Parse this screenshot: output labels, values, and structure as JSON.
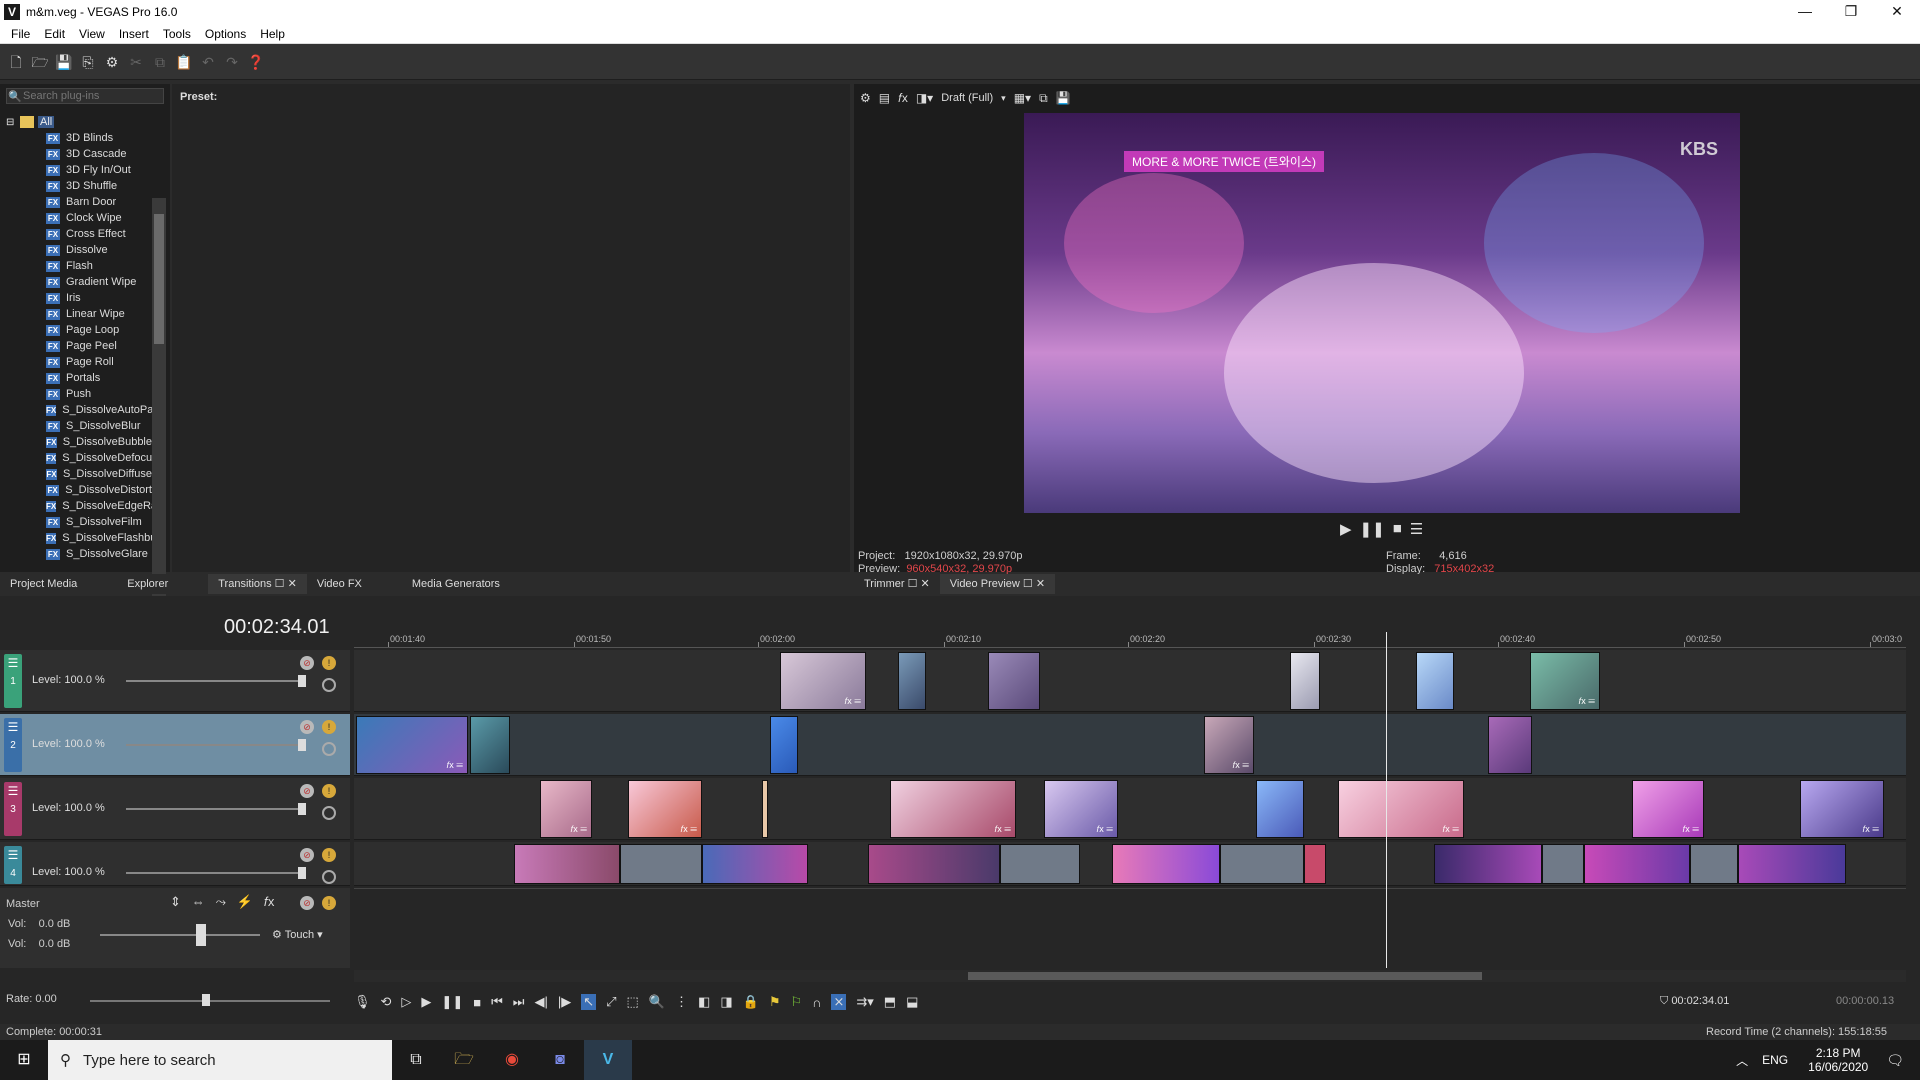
{
  "window": {
    "title": "m&m.veg - VEGAS Pro 16.0",
    "app_icon": "V"
  },
  "menu": [
    "File",
    "Edit",
    "View",
    "Insert",
    "Tools",
    "Options",
    "Help"
  ],
  "plugins": {
    "search_placeholder": "Search plug-ins",
    "root_label": "All",
    "items": [
      "3D Blinds",
      "3D Cascade",
      "3D Fly In/Out",
      "3D Shuffle",
      "Barn Door",
      "Clock Wipe",
      "Cross Effect",
      "Dissolve",
      "Flash",
      "Gradient Wipe",
      "Iris",
      "Linear Wipe",
      "Page Loop",
      "Page Peel",
      "Page Roll",
      "Portals",
      "Push",
      "S_DissolveAutoPa",
      "S_DissolveBlur",
      "S_DissolveBubble",
      "S_DissolveDefocu",
      "S_DissolveDiffuse",
      "S_DissolveDistort",
      "S_DissolveEdgeRa",
      "S_DissolveFilm",
      "S_DissolveFlashbu",
      "S_DissolveGlare"
    ],
    "fx_badge": "FX"
  },
  "preset": {
    "label": "Preset:"
  },
  "left_tabs": [
    "Project Media",
    "Explorer",
    "Transitions",
    "Video FX",
    "Media Generators"
  ],
  "preview": {
    "quality": "Draft (Full)",
    "banner": "MORE & MORE  TWICE (트와이스)",
    "watermark": "KBS",
    "project_label": "Project:",
    "project_value": "1920x1080x32, 29.970p",
    "preview_label": "Preview:",
    "preview_value": "960x540x32, 29.970p",
    "frame_label": "Frame:",
    "frame_value": "4,616",
    "display_label": "Display:",
    "display_value": "715x402x32"
  },
  "preview_tabs": [
    "Trimmer",
    "Video Preview"
  ],
  "timeline": {
    "timecode": "00:02:34.01",
    "ruler": [
      "00:01:40",
      "00:01:50",
      "00:02:00",
      "00:02:10",
      "00:02:20",
      "00:02:30",
      "00:02:40",
      "00:02:50",
      "00:03:0"
    ],
    "tracks": [
      {
        "num": "1",
        "level": "Level: 100.0 %"
      },
      {
        "num": "2",
        "level": "Level: 100.0 %"
      },
      {
        "num": "3",
        "level": "Level: 100.0 %"
      },
      {
        "num": "4",
        "level": "Level: 100.0 %"
      }
    ],
    "master": {
      "label": "Master",
      "vol1_label": "Vol:",
      "vol1": "0.0 dB",
      "vol2_label": "Vol:",
      "vol2": "0.0 dB",
      "mode": "Touch"
    },
    "rate": "Rate: 0.00",
    "cursor_time": "00:02:34.01",
    "end_time": "00:00:00.13"
  },
  "status": {
    "complete": "Complete: 00:00:31",
    "record": "Record Time (2 channels): 155:18:55"
  },
  "taskbar": {
    "search": "Type here to search",
    "lang": "ENG",
    "time": "2:18 PM",
    "date": "16/06/2020"
  }
}
